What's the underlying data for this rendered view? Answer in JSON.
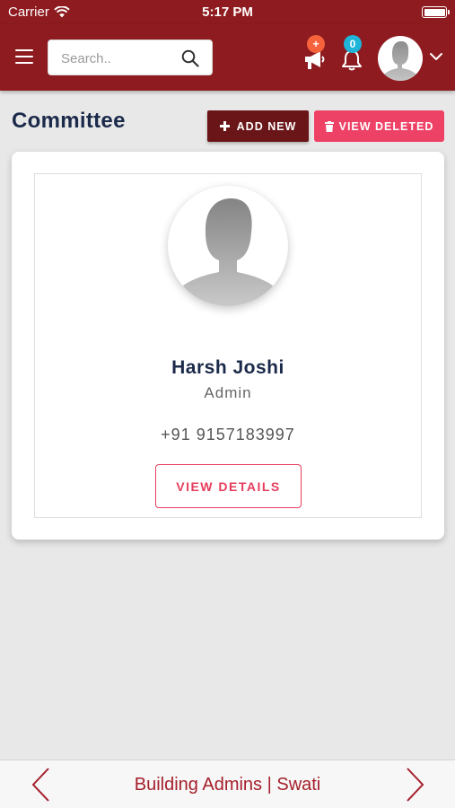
{
  "status_bar": {
    "carrier": "Carrier",
    "time": "5:17 PM"
  },
  "app_bar": {
    "search": {
      "placeholder": "Search.."
    },
    "announce_badge": "+",
    "notification_count": "0"
  },
  "page": {
    "title": "Committee",
    "add_new_label": "ADD NEW",
    "view_deleted_label": "VIEW DELETED"
  },
  "member": {
    "name": "Harsh Joshi",
    "role": "Admin",
    "phone": "+91 9157183997",
    "details_label": "VIEW DETAILS"
  },
  "bottom_nav": {
    "label": "Building Admins | Swati"
  },
  "colors": {
    "header": "#8e1b1f",
    "add_button": "#6a1618",
    "accent_pink": "#ee4166",
    "badge_orange": "#f5623c",
    "badge_cyan": "#1fb5d8",
    "title_navy": "#1b2a4a"
  },
  "icons": [
    "wifi-icon",
    "battery-icon",
    "menu-icon",
    "search-icon",
    "megaphone-icon",
    "bell-icon",
    "avatar",
    "chevron-down-icon",
    "plus-icon",
    "trash-icon",
    "chevron-left-icon",
    "chevron-right-icon"
  ]
}
